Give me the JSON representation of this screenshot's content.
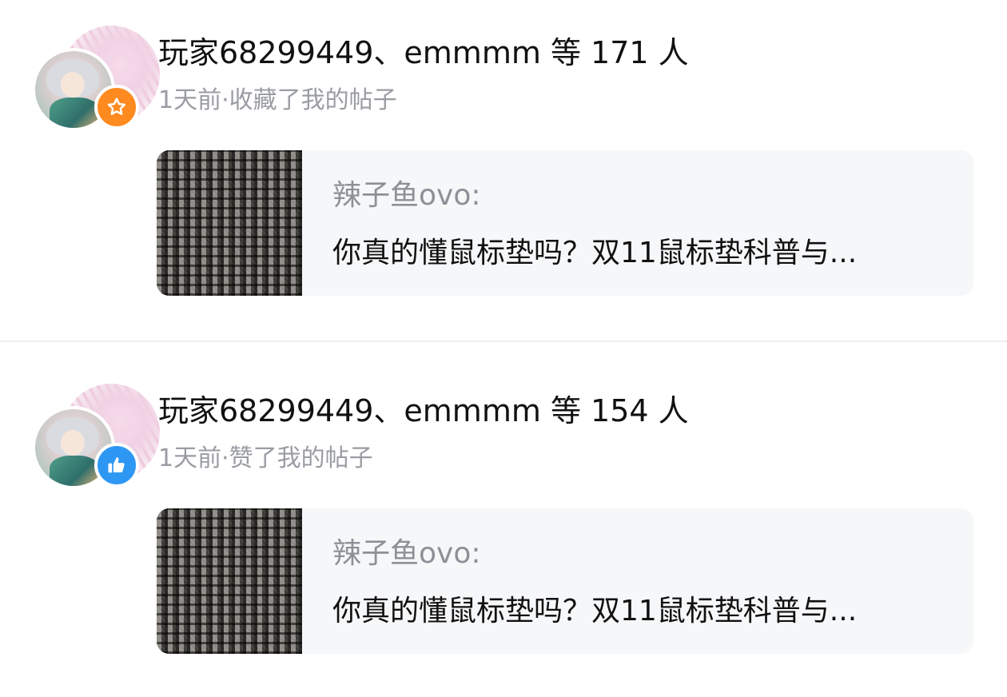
{
  "notifications": [
    {
      "title": "玩家68299449、emmmm 等 171 人",
      "subtitle": "1天前·收藏了我的帖子",
      "badge_icon": "star-icon",
      "badge_color": "#ff8a1f",
      "post": {
        "author": "辣子鱼ovo:",
        "title": "你真的懂鼠标垫吗？双11鼠标垫科普与..."
      }
    },
    {
      "title": "玩家68299449、emmmm 等 154 人",
      "subtitle": "1天前·赞了我的帖子",
      "badge_icon": "thumbs-up-icon",
      "badge_color": "#2e97f4",
      "post": {
        "author": "辣子鱼ovo:",
        "title": "你真的懂鼠标垫吗？双11鼠标垫科普与..."
      }
    }
  ]
}
